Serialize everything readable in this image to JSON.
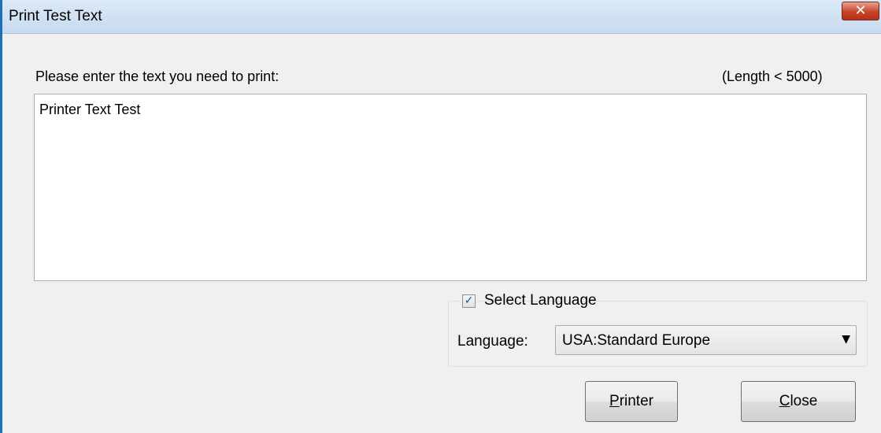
{
  "window": {
    "title": "Print Test Text",
    "close_glyph": "✕"
  },
  "prompt": {
    "label": "Please enter the text you need to print:",
    "length_note": "(Length < 5000)"
  },
  "text_input": {
    "value": "Printer Text Test"
  },
  "language_group": {
    "checkbox_label": "Select Language",
    "checked": true,
    "check_glyph": "✓",
    "language_label": "Language:",
    "selected_language": "USA:Standard Europe",
    "dropdown_icon": "▼"
  },
  "buttons": {
    "printer": {
      "mnemonic": "P",
      "rest": "rinter"
    },
    "close": {
      "mnemonic": "C",
      "rest": "lose"
    }
  },
  "colors": {
    "title_bar": "#c6daf0",
    "close_button": "#c7442a",
    "window_background": "#f0f0f0"
  }
}
